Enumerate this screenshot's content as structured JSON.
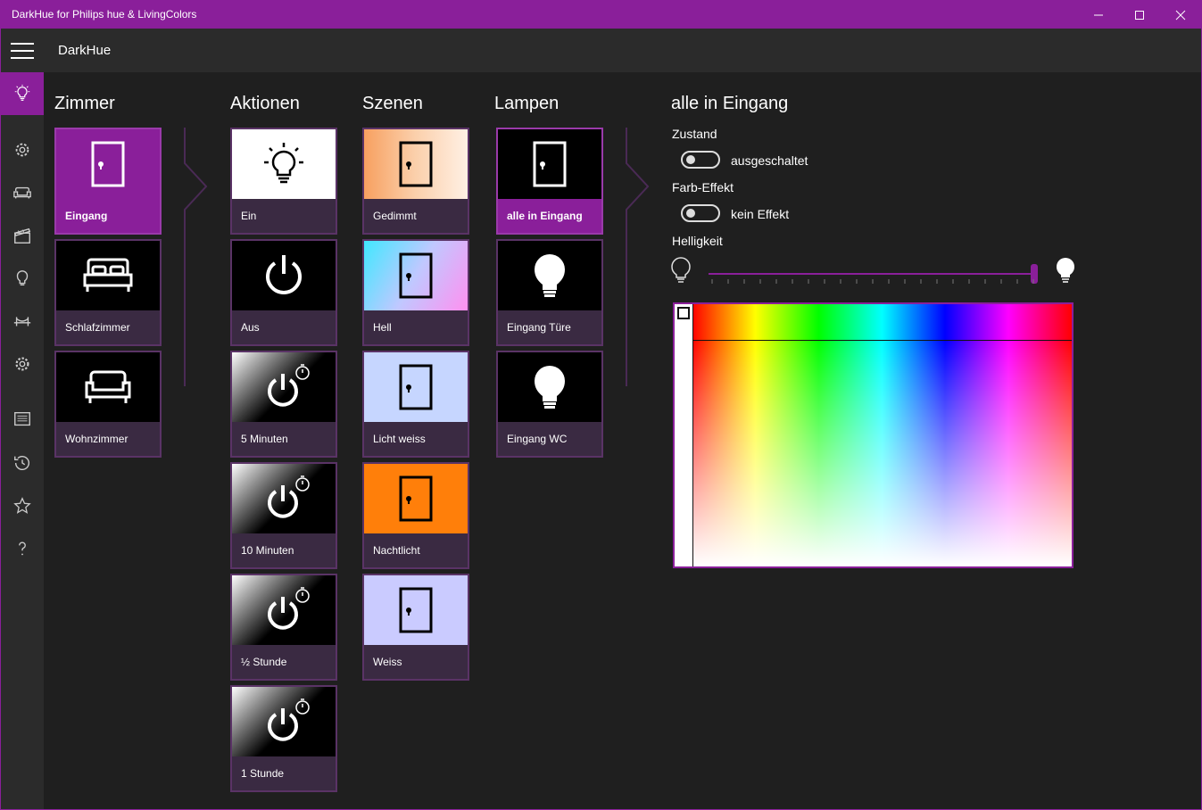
{
  "window": {
    "title": "DarkHue for Philips hue & LivingColors",
    "accent": "#8a1f9a"
  },
  "appbar": {
    "name": "DarkHue"
  },
  "sidebar": {
    "items": [
      {
        "icon": "bulb-icon",
        "active": true
      },
      {
        "icon": "bridge-gear-icon"
      },
      {
        "icon": "sofa-icon"
      },
      {
        "icon": "clapperboard-icon"
      },
      {
        "icon": "lightbulb-icon"
      },
      {
        "icon": "bridge-icon"
      },
      {
        "icon": "settings-icon"
      },
      {
        "icon": "log-icon"
      },
      {
        "icon": "history-icon"
      },
      {
        "icon": "star-icon"
      },
      {
        "icon": "help-icon"
      }
    ]
  },
  "columns": {
    "zimmer": {
      "title": "Zimmer",
      "items": [
        {
          "label": "Eingang",
          "icon": "door-icon",
          "selected": true
        },
        {
          "label": "Schlafzimmer",
          "icon": "bed-icon"
        },
        {
          "label": "Wohnzimmer",
          "icon": "sofa-icon"
        }
      ]
    },
    "aktionen": {
      "title": "Aktionen",
      "items": [
        {
          "label": "Ein",
          "icon": "bulb-on-icon"
        },
        {
          "label": "Aus",
          "icon": "power-icon"
        },
        {
          "label": "5 Minuten",
          "icon": "power-timer-icon"
        },
        {
          "label": "10 Minuten",
          "icon": "power-timer-icon"
        },
        {
          "label": "½ Stunde",
          "icon": "power-timer-icon"
        },
        {
          "label": "1 Stunde",
          "icon": "power-timer-icon"
        }
      ]
    },
    "szenen": {
      "title": "Szenen",
      "items": [
        {
          "label": "Gedimmt",
          "icon": "door-icon"
        },
        {
          "label": "Hell",
          "icon": "door-icon"
        },
        {
          "label": "Licht weiss",
          "icon": "door-icon"
        },
        {
          "label": "Nachtlicht",
          "icon": "door-icon"
        },
        {
          "label": "Weiss",
          "icon": "door-icon"
        }
      ]
    },
    "lampen": {
      "title": "Lampen",
      "items": [
        {
          "label": "alle in Eingang",
          "icon": "door-icon",
          "selected": true
        },
        {
          "label": "Eingang Türe",
          "icon": "lightbulb-icon"
        },
        {
          "label": "Eingang WC",
          "icon": "lightbulb-icon"
        }
      ]
    }
  },
  "detail": {
    "title": "alle in Eingang",
    "zustand": {
      "label": "Zustand",
      "value": "ausgeschaltet",
      "on": false
    },
    "farbeffekt": {
      "label": "Farb-Effekt",
      "value": "kein Effekt",
      "on": false
    },
    "helligkeit": {
      "label": "Helligkeit",
      "value_fraction": 1.0
    }
  }
}
